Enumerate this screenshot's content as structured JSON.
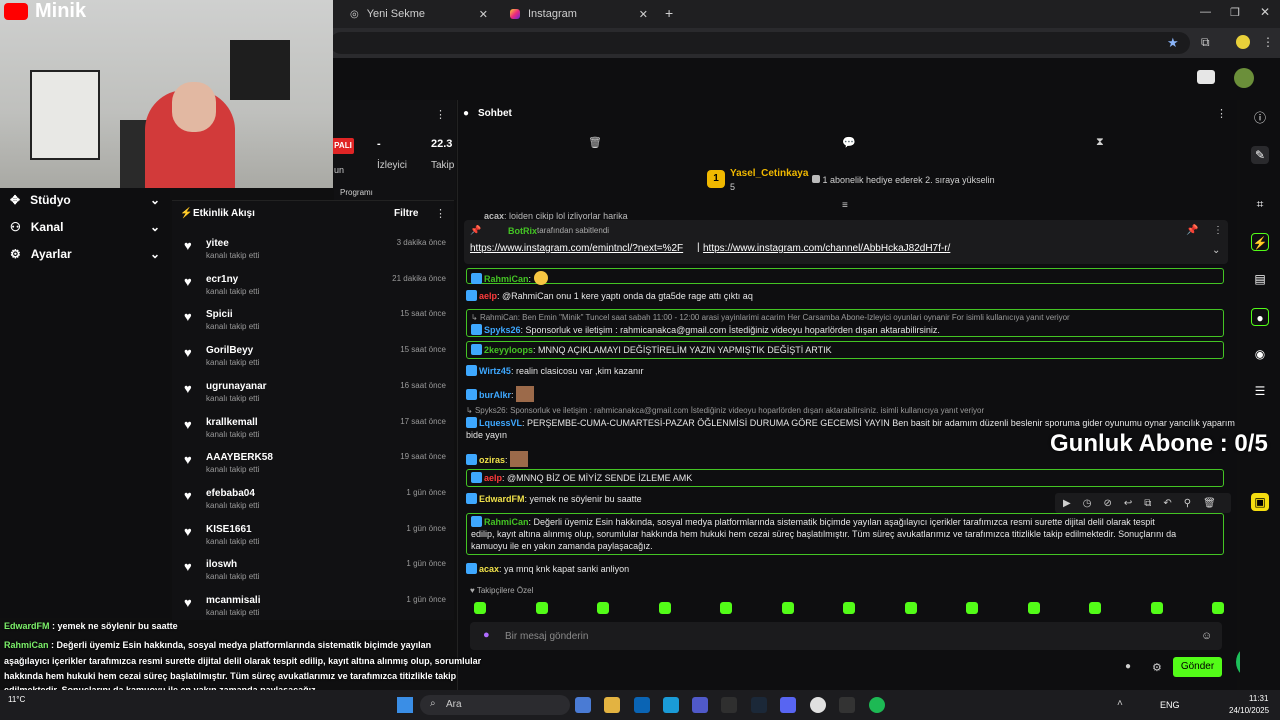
{
  "browser": {
    "tabs": [
      {
        "label": "Yeni Sekme"
      },
      {
        "label": "Instagram"
      }
    ]
  },
  "streamer_overlay": {
    "name": "Minik"
  },
  "stats": {
    "live_badge": "PALI",
    "viewers_value": "-",
    "viewers_label": "İzleyici",
    "followers_value": "22.3",
    "followers_label": "Takip",
    "fragment1": "un",
    "fragment2": "Programı"
  },
  "left_nav": {
    "items": [
      {
        "label": "Stüdyo"
      },
      {
        "label": "Kanal"
      },
      {
        "label": "Ayarlar"
      }
    ]
  },
  "activity": {
    "title": "Etkinlik Akışı",
    "filter": "Filtre",
    "items": [
      {
        "name": "yitee",
        "sub": "kanalı takip etti",
        "time": "3 dakika önce"
      },
      {
        "name": "ecr1ny",
        "sub": "kanalı takip etti",
        "time": "21 dakika önce"
      },
      {
        "name": "Spicii",
        "sub": "kanalı takip etti",
        "time": "15 saat önce"
      },
      {
        "name": "GorilBeyy",
        "sub": "kanalı takip etti",
        "time": "15 saat önce"
      },
      {
        "name": "ugrunayanar",
        "sub": "kanalı takip etti",
        "time": "16 saat önce"
      },
      {
        "name": "krallkemall",
        "sub": "kanalı takip etti",
        "time": "17 saat önce"
      },
      {
        "name": "AAAYBERK58",
        "sub": "kanalı takip etti",
        "time": "19 saat önce"
      },
      {
        "name": "efebaba04",
        "sub": "kanalı takip etti",
        "time": "1 gün önce"
      },
      {
        "name": "KISE1661",
        "sub": "kanalı takip etti",
        "time": "1 gün önce"
      },
      {
        "name": "iloswh",
        "sub": "kanalı takip etti",
        "time": "1 gün önce"
      },
      {
        "name": "mcanmisali",
        "sub": "kanalı takip etti",
        "time": "1 gün önce"
      }
    ]
  },
  "chat": {
    "title": "Sohbet",
    "top_gifter": {
      "rank": "1",
      "name": "Yasel_Cetinkaya",
      "count": "5",
      "note": "1 abonelik hediye ederek 2. sıraya yükselin"
    },
    "pinned": {
      "cut_line_user": "acax",
      "cut_line_text": "loiden cikip lol izliyorlar harika",
      "pinner": "BotRix",
      "pin_note": "tarafından sabitlendi",
      "link1": "https://www.instagram.com/emintncl/?next=%2F",
      "separator": "|",
      "link2": "https://www.instagram.com/channel/AbbHckaJ82dH7f-r/"
    },
    "messages": [
      {
        "user": "RahmiCan",
        "text": "",
        "color": "#44c424"
      },
      {
        "user": "aelp",
        "text": "@RahmiCan onu 1 kere yaptı onda da gta5de rage attı çıktı aq",
        "color": "#ff3b3b"
      },
      {
        "reply": "RahmiCan: Ben Emin \"Minik\" Tuncel saat sabah 11:00 - 12:00 arasi yayinlarimi acarim Her Carsamba Abone-Izleyici oyunlari oynanir For isimli kullanıcıya yanıt veriyor",
        "user": "Spyks26",
        "text": "Sponsorluk ve iletişim : rahmicanakca@gmail.com İstediğiniz videoyu hoparlörden dışarı aktarabilirsiniz.",
        "color": "#3ea8ff"
      },
      {
        "user": "2keyyloops",
        "text": "MNNQ AÇIKLAMAYI DEĞİŞTİRELİM YAZIN YAPMIŞTIK DEĞİŞTİ ARTIK",
        "color": "#44c424"
      },
      {
        "user": "Wirtz45",
        "text": "realin clasicosu var ,kim kazanır",
        "color": "#3ea8ff"
      },
      {
        "user": "burAlkr",
        "text": "",
        "color": "#3ea8ff"
      },
      {
        "reply": "Spyks26: Sponsorluk ve iletişim : rahmicanakca@gmail.com İstediğiniz videoyu hoparlörden dışarı aktarabilirsiniz. isimli kullanıcıya yanıt veriyor",
        "user": "LquessVL",
        "text": "PERŞEMBE-CUMA-CUMARTESİ-PAZAR ÖĞLENMİSİ DURUMA GÖRE GECEMSİ YAYIN Ben basit bir adamım düzenli beslenir sporuma gider oyunumu oynar yancılık yaparım",
        "text2": "bide yayın",
        "color": "#3ea8ff"
      },
      {
        "user": "oziras",
        "text": "",
        "color": "#f0e14a"
      },
      {
        "user": "aelp",
        "text": "@MNNQ BİZ OE MİYİZ SENDE İZLEME AMK",
        "color": "#ff3b3b"
      },
      {
        "user": "EdwardFM",
        "text": "yemek ne söylenir bu saatte",
        "color": "#f0e14a"
      },
      {
        "user": "RahmiCan",
        "text": "Değerli üyemiz Esin hakkında, sosyal medya platformlarında sistematik biçimde yayılan aşağılayıcı içerikler tarafımızca resmi surette dijital delil olarak tespit",
        "text2": "edilip, kayıt altına alınmış olup, sorumlular hakkında hem hukuki hem cezai süreç başlatılmıştır. Tüm süreç avukatlarımız ve tarafımızca titizlikle takip edilmektedir. Sonuçlarını da",
        "text3": "kamuoyu ile en yakın zamanda paylaşacağız.",
        "color": "#44c424"
      },
      {
        "user": "acax",
        "text": "ya mnq knk kapat sanki anliyon",
        "color": "#f0e14a"
      }
    ],
    "emote_section": "Takipçilere Özel",
    "input_placeholder": "Bir mesaj gönderin",
    "send_label": "Gönder"
  },
  "overlay_counter": "Gunluk Abone : 0/5",
  "bottom_overlay_chat": [
    {
      "user": "EdwardFM",
      "text": " : yemek ne söylenir bu saatte"
    },
    {
      "user": "RahmiCan",
      "text": " : Değerli üyemiz Esin hakkında, sosyal medya platformlarında sistematik biçimde yayılan"
    },
    {
      "user": "",
      "text": "aşağılayıcı içerikler tarafımızca resmi surette dijital delil olarak tespit edilip, kayıt altına alınmış olup, sorumlular"
    },
    {
      "user": "",
      "text": "hakkında hem hukuki hem cezai süreç başlatılmıştır. Tüm süreç avukatlarımız ve tarafımızca titizlikle takip"
    },
    {
      "user": "",
      "text": "edilmektedir. Sonuçlarını da kamuoyu ile en yakın zamanda paylaşacağız."
    },
    {
      "user": "acax",
      "text": " : ya mnq knk kapat sanki anliyon"
    }
  ],
  "taskbar": {
    "search": "Ara",
    "weather": "11°C",
    "lang": "ENG",
    "time": "11:31",
    "date": "24/10/2025"
  },
  "colors": {
    "accent_green": "#53fc18",
    "box_border": "#44c424",
    "bg": "#0e0e10"
  }
}
